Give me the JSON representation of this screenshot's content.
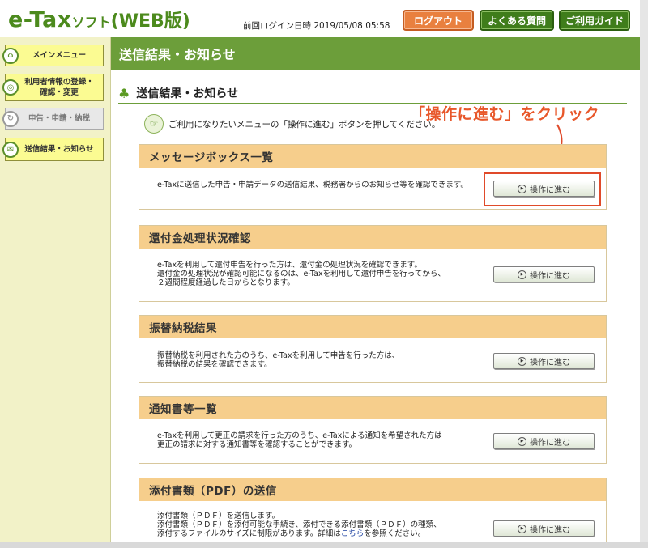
{
  "header": {
    "logo_main": "e-Tax",
    "logo_soft": "ソフト",
    "logo_web": "(WEB版)",
    "last_login_label": "前回ログイン日時",
    "last_login_value": "2019/05/08 05:58",
    "logout": "ログアウト",
    "faq": "よくある質問",
    "guide": "ご利用ガイド"
  },
  "sidebar": {
    "items": [
      {
        "label": "メインメニュー",
        "icon": "house-icon",
        "state": "active"
      },
      {
        "label": "利用者情報の登録・\n確認・変更",
        "icon": "target-icon",
        "state": "active"
      },
      {
        "label": "申告・申請・納税",
        "icon": "refresh-icon",
        "state": "disabled"
      },
      {
        "label": "送信結果・お知らせ",
        "icon": "mail-icon",
        "state": "active"
      }
    ]
  },
  "main": {
    "title": "送信結果・お知らせ",
    "section_title": "送信結果・お知らせ",
    "intro": "ご利用になりたいメニューの「操作に進む」ボタンを押してください。",
    "annotation": "「操作に進む」をクリック",
    "operate_label": "操作に進む",
    "cards": [
      {
        "title": "メッセージボックス一覧",
        "text": "e-Taxに送信した申告・申請データの送信結果、税務署からのお知らせ等を確認できます。"
      },
      {
        "title": "還付金処理状況確認",
        "text": "e-Taxを利用して還付申告を行った方は、還付金の処理状況を確認できます。\n還付金の処理状況が確認可能になるのは、e-Taxを利用して還付申告を行ってから、\n２週間程度経過した日からとなります。"
      },
      {
        "title": "振替納税結果",
        "text": "振替納税を利用された方のうち、e-Taxを利用して申告を行った方は、\n振替納税の結果を確認できます。"
      },
      {
        "title": "通知書等一覧",
        "text": "e-Taxを利用して更正の請求を行った方のうち、e-Taxによる通知を希望された方は\n更正の請求に対する通知書等を確認することができます。"
      },
      {
        "title": "添付書類（PDF）の送信",
        "text_line1": "添付書類（ＰＤＦ）を送信します。",
        "text_line2": "添付書類（ＰＤＦ）を添付可能な手続き、添付できる添付書類（ＰＤＦ）の種類、",
        "text_line3_pre": "添付するファイルのサイズに制限があります。詳細は",
        "text_link": "こちら",
        "text_line3_post": "を参照ください。"
      }
    ]
  },
  "colors": {
    "accent_green": "#6c9e3a",
    "logo_green": "#4c8a1d",
    "logout_orange": "#e9803f",
    "card_header": "#f6ce8c",
    "annotation_red": "#e04a2a"
  }
}
